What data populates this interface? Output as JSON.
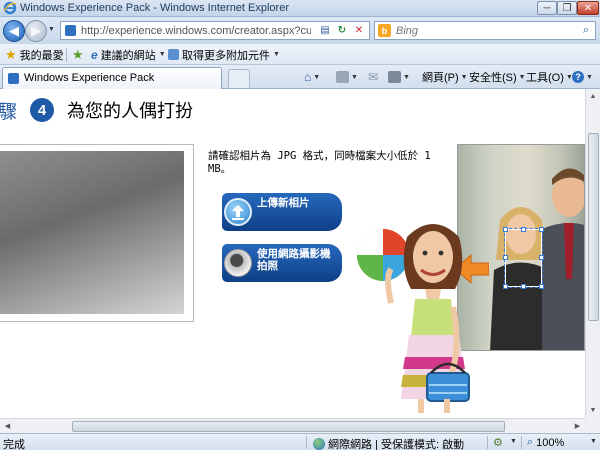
{
  "window": {
    "title": "Windows Experience Pack - Windows Internet Explorer",
    "minimize": "─",
    "maximize": "❐",
    "close": "✕"
  },
  "address": {
    "url": "http://experience.windows.com/creator.aspx?culture",
    "search_placeholder": "Bing",
    "bing_glyph": "b"
  },
  "favorites": {
    "my_favorites": "我的最愛",
    "suggested_sites": "建議的網站",
    "more_addons": "取得更多附加元件"
  },
  "tab": {
    "label": "Windows Experience Pack"
  },
  "commands": {
    "page": "網頁(P)",
    "safety": "安全性(S)",
    "tools": "工具(O)"
  },
  "content": {
    "step_prefix": "驟",
    "step_number": "4",
    "step_title": "為您的人偶打扮",
    "instructions": "請確認相片為 JPG 格式，同時檔案大小低於 1 MB。",
    "upload_label": "上傳新相片",
    "webcam_label": "使用網路攝影機拍照"
  },
  "status": {
    "done": "完成",
    "zone": "網際網路 | 受保護模式: 啟動",
    "zoom": "100%"
  },
  "colors": {
    "accent_blue": "#1f5aa6",
    "button_blue": "#0e3f86",
    "arrow_orange": "#f08a24"
  },
  "icons": {
    "back": "back-arrow-icon",
    "forward": "forward-arrow-icon",
    "refresh": "refresh-icon",
    "stop": "stop-icon",
    "search": "search-icon",
    "favorites": "star-icon",
    "home": "home-icon",
    "feeds": "rss-icon",
    "mail": "mail-icon",
    "print": "printer-icon",
    "help": "help-icon",
    "upload": "upload-icon",
    "webcam": "webcam-icon"
  }
}
